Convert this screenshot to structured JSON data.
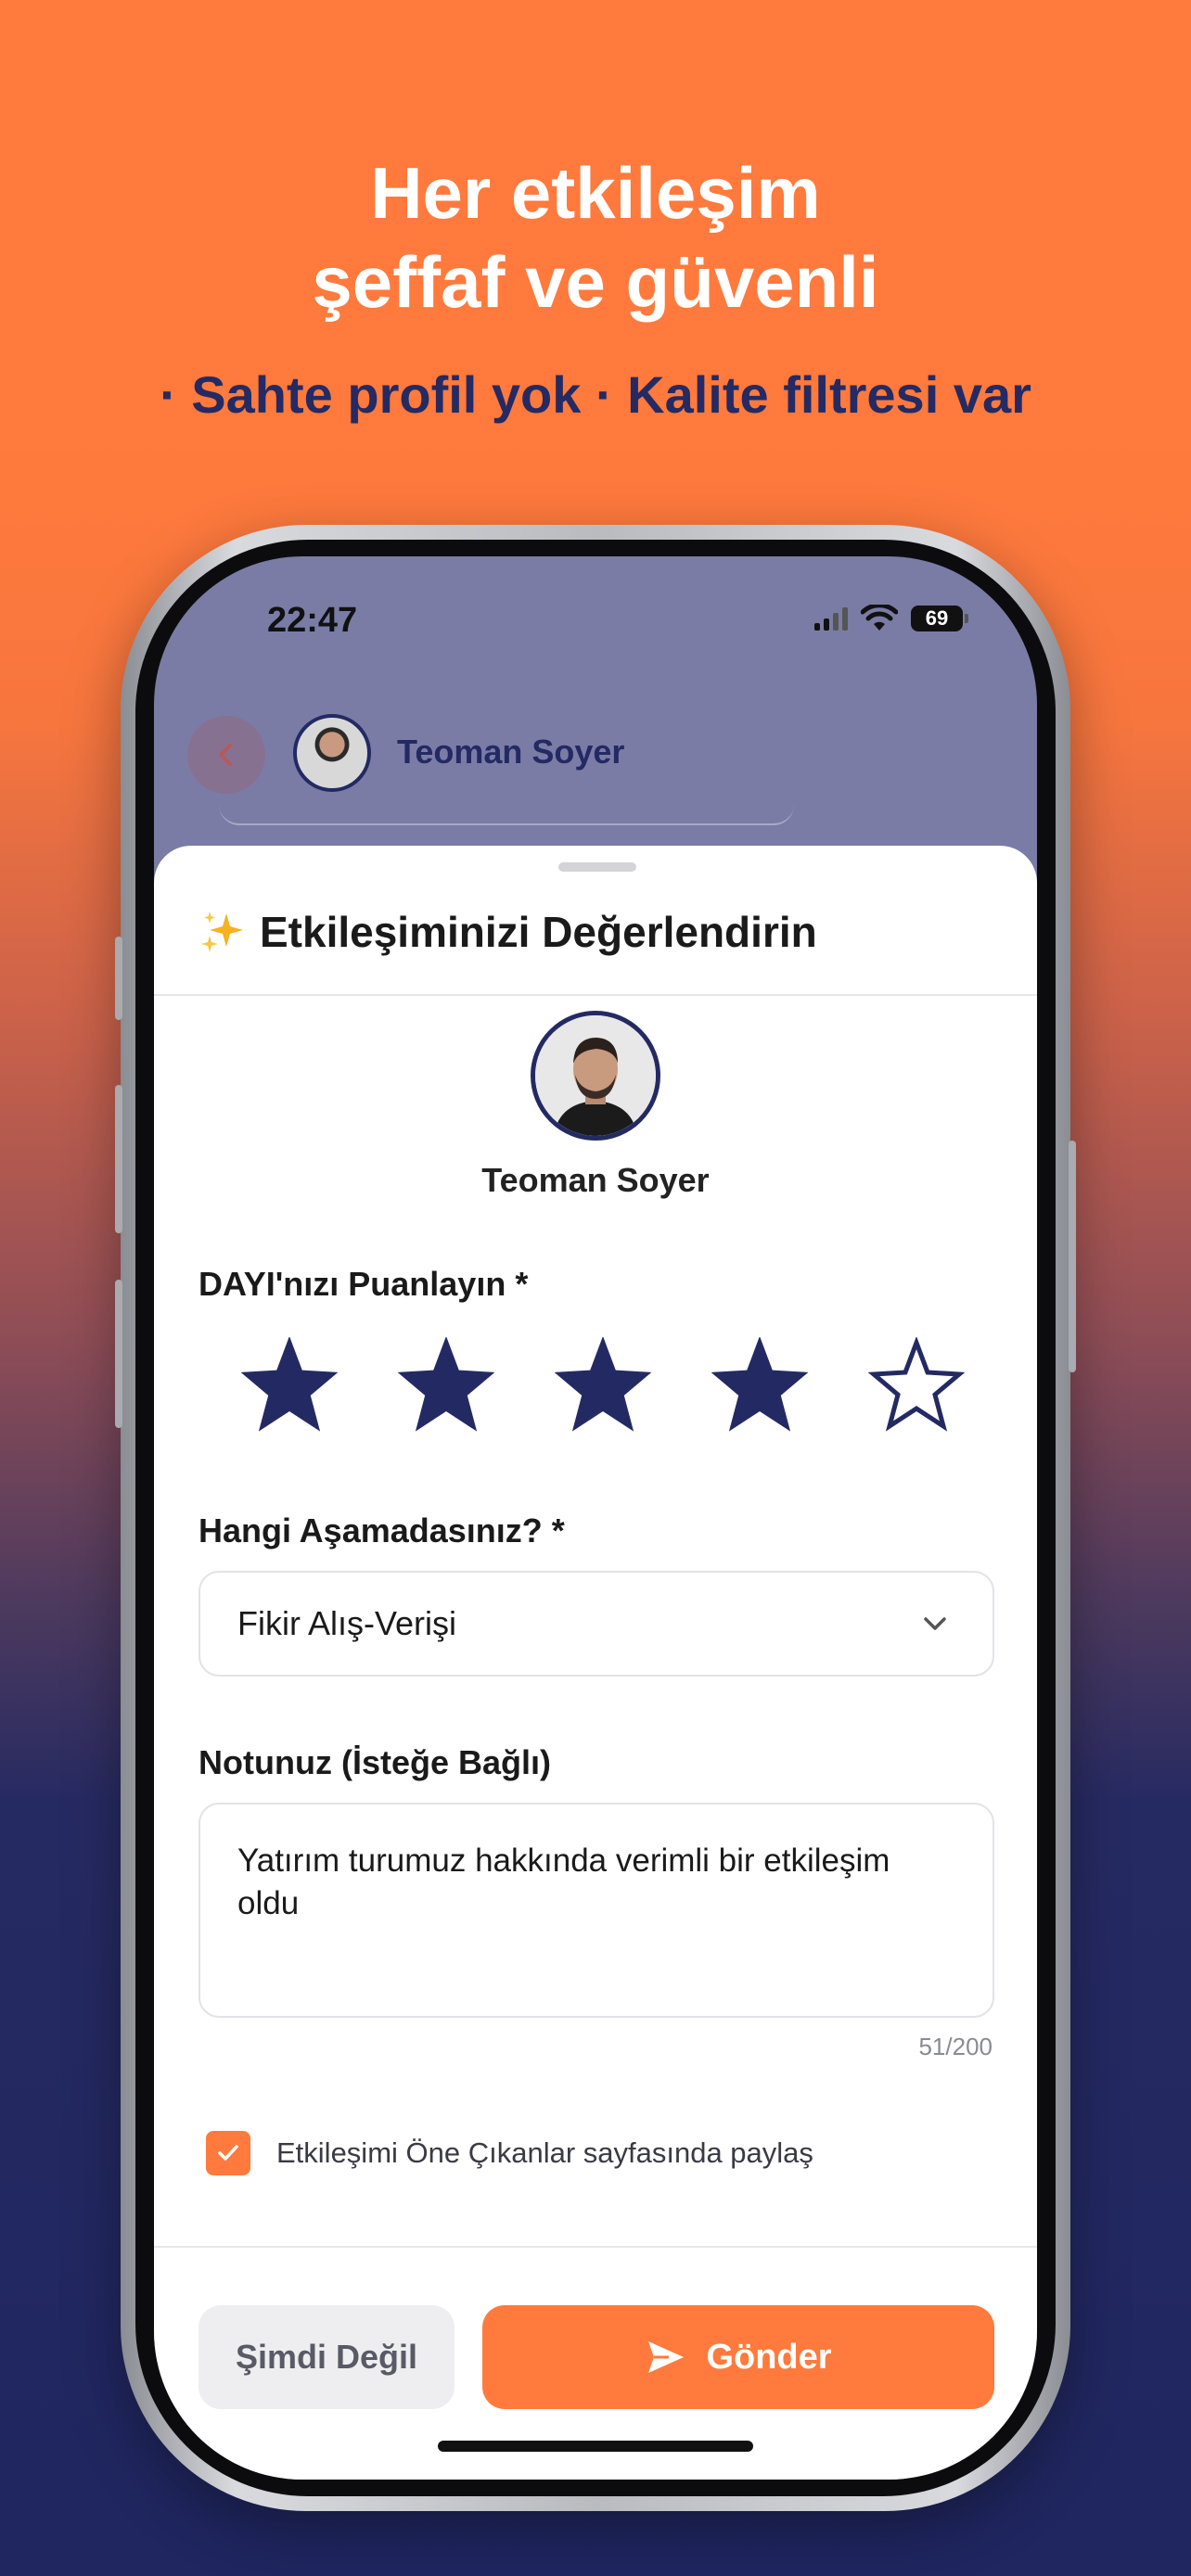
{
  "promo": {
    "headline_line1": "Her etkileşim",
    "headline_line2": "şeffaf ve güvenli",
    "subline": "· Sahte profil yok · Kalite filtresi var"
  },
  "status_bar": {
    "time": "22:47",
    "battery": "69",
    "icons": [
      "signal-icon",
      "wifi-icon",
      "battery-icon"
    ]
  },
  "background_chat": {
    "contact_name": "Teoman Soyer",
    "back_icon": "chevron-left-icon"
  },
  "sheet": {
    "title": "Etkileşiminizi Değerlendirin",
    "title_icon": "sparkles-icon",
    "user_name": "Teoman Soyer",
    "rating_label": "DAYI'nızı Puanlayın *",
    "rating": {
      "value": 4,
      "max": 5
    },
    "stage_label": "Hangi Aşamadasınız? *",
    "stage_selected": "Fikir Alış-Verişi",
    "note_label": "Notunuz (İsteğe Bağlı)",
    "note_value": "Yatırım turumuz hakkında verimli bir etkileşim oldu",
    "note_counter": "51/200",
    "share_label": "Etkileşimi Öne Çıkanlar sayfasında paylaş",
    "share_checked": true,
    "cancel_label": "Şimdi Değil",
    "submit_label": "Gönder"
  },
  "colors": {
    "accent": "#FF7A3C",
    "navy": "#232A63",
    "background_bottom": "#1F2660"
  }
}
